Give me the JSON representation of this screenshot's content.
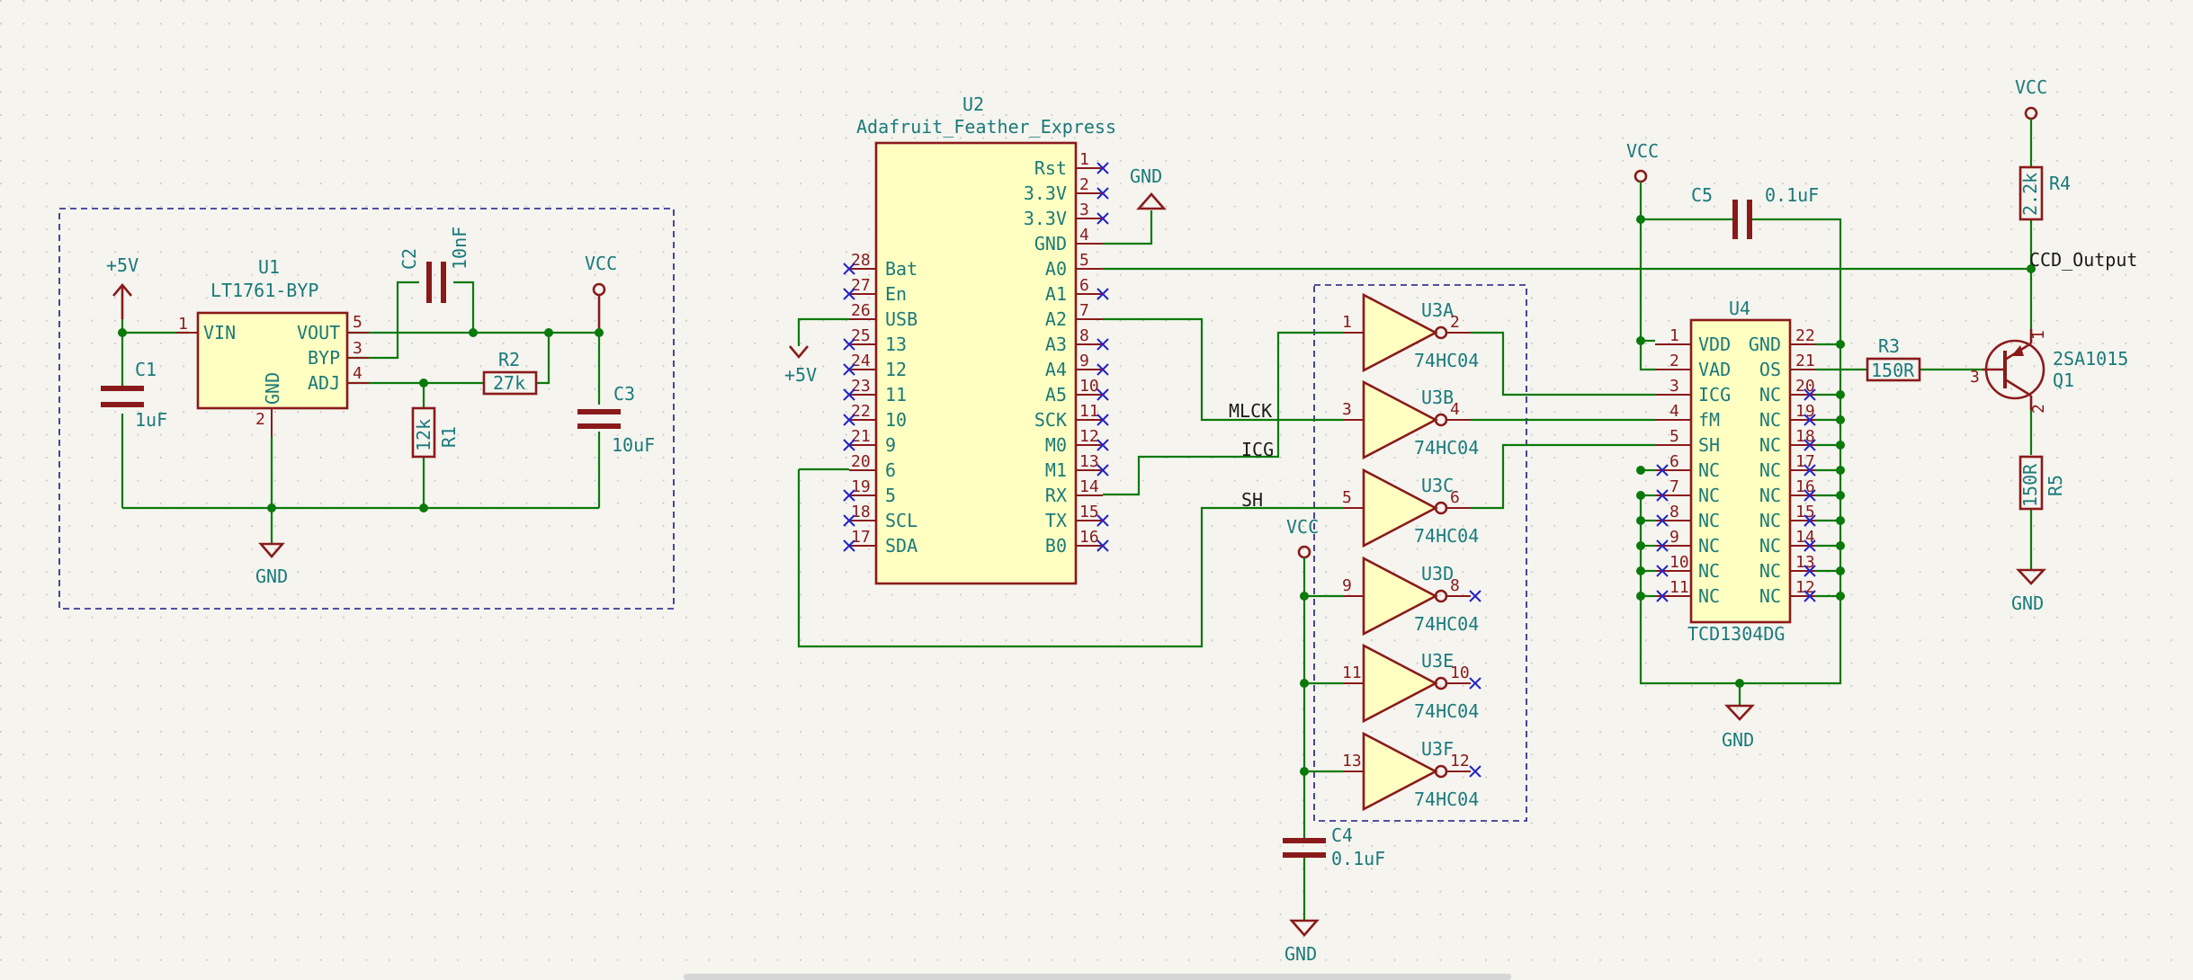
{
  "power": {
    "p5v": "+5V",
    "vcc": "VCC",
    "gnd": "GND"
  },
  "u1": {
    "ref": "U1",
    "value": "LT1761-BYP",
    "pins": {
      "vin": "VIN",
      "vout": "VOUT",
      "byp": "BYP",
      "adj": "ADJ",
      "gnd": "GND"
    },
    "pin_nums": {
      "vin": "1",
      "vout": "5",
      "byp": "3",
      "adj": "4",
      "gnd": "2"
    }
  },
  "c1": {
    "ref": "C1",
    "value": "1uF"
  },
  "c2": {
    "ref": "C2",
    "value": "10nF"
  },
  "c3": {
    "ref": "C3",
    "value": "10uF"
  },
  "c4": {
    "ref": "C4",
    "value": "0.1uF"
  },
  "c5": {
    "ref": "C5",
    "value": "0.1uF"
  },
  "r1": {
    "ref": "R1",
    "value": "12k"
  },
  "r2": {
    "ref": "R2",
    "value": "27k"
  },
  "r3": {
    "ref": "R3",
    "value": "150R"
  },
  "r4": {
    "ref": "R4",
    "value": "2.2k"
  },
  "r5": {
    "ref": "R5",
    "value": "150R"
  },
  "u2": {
    "ref": "U2",
    "value": "Adafruit_Feather_Express",
    "left_pins": [
      "Bat",
      "En",
      "USB",
      "13",
      "12",
      "11",
      "10",
      "9",
      "6",
      "5",
      "SCL",
      "SDA"
    ],
    "left_nums": [
      "28",
      "27",
      "26",
      "25",
      "24",
      "23",
      "22",
      "21",
      "20",
      "19",
      "18",
      "17"
    ],
    "right_pins": [
      "Rst",
      "3.3V",
      "3.3V",
      "GND",
      "A0",
      "A1",
      "A2",
      "A3",
      "A4",
      "A5",
      "SCK",
      "M0",
      "M1",
      "RX",
      "TX",
      "B0"
    ],
    "right_nums": [
      "1",
      "2",
      "3",
      "4",
      "5",
      "6",
      "7",
      "8",
      "9",
      "10",
      "11",
      "12",
      "13",
      "14",
      "15",
      "16"
    ]
  },
  "u3": {
    "value": "74HC04",
    "units": [
      {
        "ref": "U3A",
        "in": "1",
        "out": "2"
      },
      {
        "ref": "U3B",
        "in": "3",
        "out": "4"
      },
      {
        "ref": "U3C",
        "in": "5",
        "out": "6"
      },
      {
        "ref": "U3D",
        "in": "9",
        "out": "8"
      },
      {
        "ref": "U3E",
        "in": "11",
        "out": "10"
      },
      {
        "ref": "U3F",
        "in": "13",
        "out": "12"
      }
    ]
  },
  "u4": {
    "ref": "U4",
    "value": "TCD1304DG",
    "left_pins": [
      "VDD",
      "VAD",
      "ICG",
      "fM",
      "SH",
      "NC",
      "NC",
      "NC",
      "NC",
      "NC",
      "NC"
    ],
    "left_nums": [
      "1",
      "2",
      "3",
      "4",
      "5",
      "6",
      "7",
      "8",
      "9",
      "10",
      "11"
    ],
    "right_pins": [
      "GND",
      "OS",
      "NC",
      "NC",
      "NC",
      "NC",
      "NC",
      "NC",
      "NC",
      "NC",
      "NC"
    ],
    "right_nums": [
      "22",
      "21",
      "20",
      "19",
      "18",
      "17",
      "16",
      "15",
      "14",
      "13",
      "12"
    ]
  },
  "q1": {
    "ref": "Q1",
    "value": "2SA1015",
    "pins": {
      "b": "3",
      "e": "1",
      "c": "2"
    }
  },
  "nets": {
    "mlck": "MLCK",
    "icg": "ICG",
    "sh": "SH",
    "ccd_output": "CCD_Output"
  }
}
